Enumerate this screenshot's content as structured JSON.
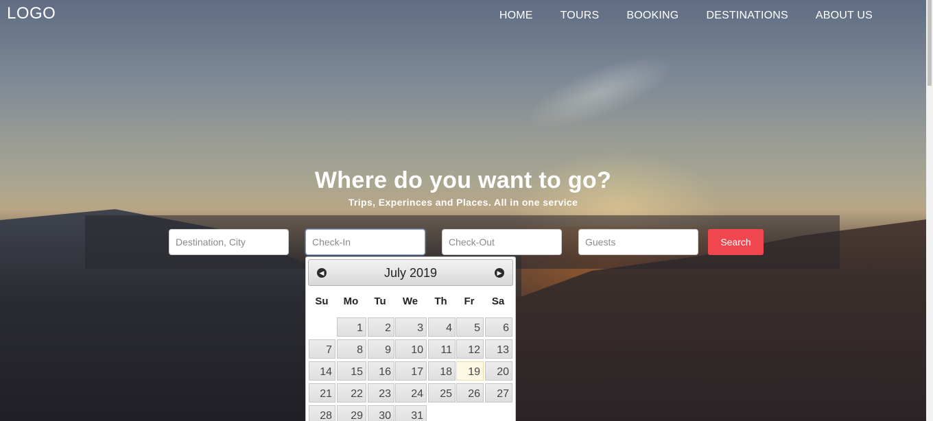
{
  "header": {
    "logo": "LOGO",
    "nav": [
      {
        "label": "HOME"
      },
      {
        "label": "TOURS"
      },
      {
        "label": "BOOKING"
      },
      {
        "label": "DESTINATIONS"
      },
      {
        "label": "ABOUT US"
      }
    ]
  },
  "hero": {
    "title": "Where do you want to go?",
    "subtitle": "Trips, Experinces and Places. All in one service"
  },
  "search": {
    "destination_placeholder": "Destination, City",
    "checkin_placeholder": "Check-In",
    "checkout_placeholder": "Check-Out",
    "guests_placeholder": "Guests",
    "button_label": "Search"
  },
  "datepicker": {
    "month_year": "July 2019",
    "prev_icon": "chevron-left-icon",
    "next_icon": "chevron-right-icon",
    "weekdays": [
      "Su",
      "Mo",
      "Tu",
      "We",
      "Th",
      "Fr",
      "Sa"
    ],
    "first_weekday_offset": 1,
    "days": [
      1,
      2,
      3,
      4,
      5,
      6,
      7,
      8,
      9,
      10,
      11,
      12,
      13,
      14,
      15,
      16,
      17,
      18,
      19,
      20,
      21,
      22,
      23,
      24,
      25,
      26,
      27,
      28,
      29,
      30,
      31
    ],
    "highlighted_day": 19
  },
  "colors": {
    "search_button": "#f0474f",
    "highlight_day": "#fcf8e3"
  }
}
